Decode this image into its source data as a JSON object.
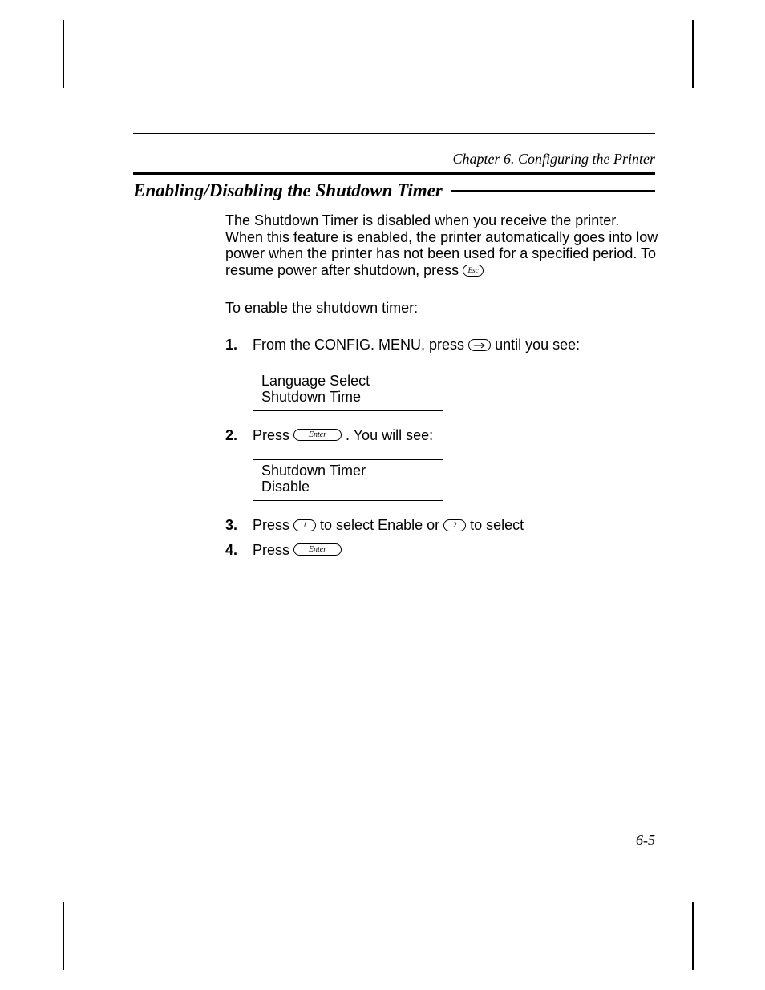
{
  "chapter_header": "Chapter 6.  Configuring the Printer",
  "section_title": "Enabling/Disabling the Shutdown Timer",
  "intro_paragraph": "The Shutdown Timer is disabled when you receive the printer. When this feature is enabled, the printer automatically goes into low power when the printer has not been used for a specified period.  To resume power after shutdown, press  ",
  "enable_lead": "To enable the shutdown timer:",
  "keys": {
    "esc": "Esc",
    "enter": "Enter",
    "one": "1",
    "two": "2"
  },
  "steps": [
    {
      "num": "1.",
      "pre": "From the CONFIG. MENU, press ",
      "post": " until you see:"
    },
    {
      "num": "2.",
      "pre": "Press ",
      "post": " .  You will see:"
    },
    {
      "num": "3.",
      "pre": "Press ",
      "mid": " to select Enable or ",
      "post": " to select"
    },
    {
      "num": "4.",
      "pre": "Press "
    }
  ],
  "displays": {
    "d1": {
      "line1": "Language Select",
      "line2": "Shutdown Time"
    },
    "d2": {
      "line1": "Shutdown Timer",
      "line2": "Disable"
    }
  },
  "page_number": "6-5"
}
